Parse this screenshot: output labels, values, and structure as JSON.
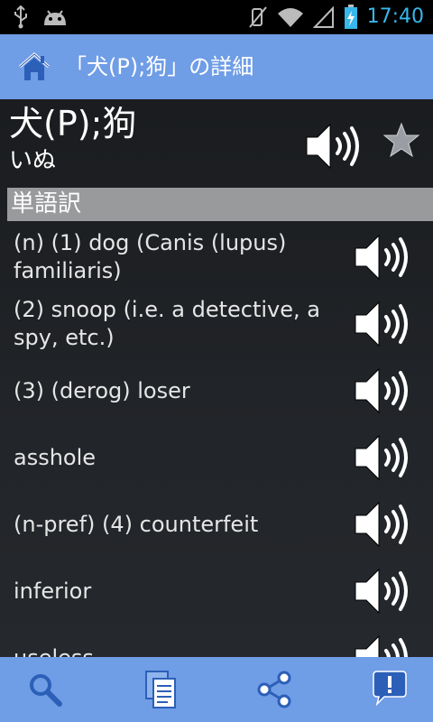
{
  "status_bar": {
    "time": "17:40",
    "icons": [
      "usb-icon",
      "android-icon",
      "mute-icon",
      "wifi-icon",
      "signal-icon",
      "battery-charging-icon"
    ]
  },
  "action_bar": {
    "title": "「犬(P);狗」の詳細",
    "home_icon": "home-icon"
  },
  "entry": {
    "headword": "犬(P);狗",
    "reading": "いぬ",
    "speaker_icon": "speaker-icon",
    "favorite_icon": "star-icon"
  },
  "section": {
    "title": "単語訳"
  },
  "translations": [
    {
      "text": "(n) (1) dog (Canis (lupus) familiaris)"
    },
    {
      "text": "(2) snoop (i.e. a detective, a spy, etc.)"
    },
    {
      "text": "(3) (derog) loser"
    },
    {
      "text": "asshole"
    },
    {
      "text": "(n-pref) (4) counterfeit"
    },
    {
      "text": "inferior"
    },
    {
      "text": "useless"
    }
  ],
  "bottom_bar": {
    "buttons": [
      "search-icon",
      "copy-icon",
      "share-icon",
      "feedback-icon"
    ]
  },
  "colors": {
    "accent": "#6f9de6",
    "clock": "#37b7ea",
    "section_header": "#999a9c",
    "background": "#1f2226"
  }
}
